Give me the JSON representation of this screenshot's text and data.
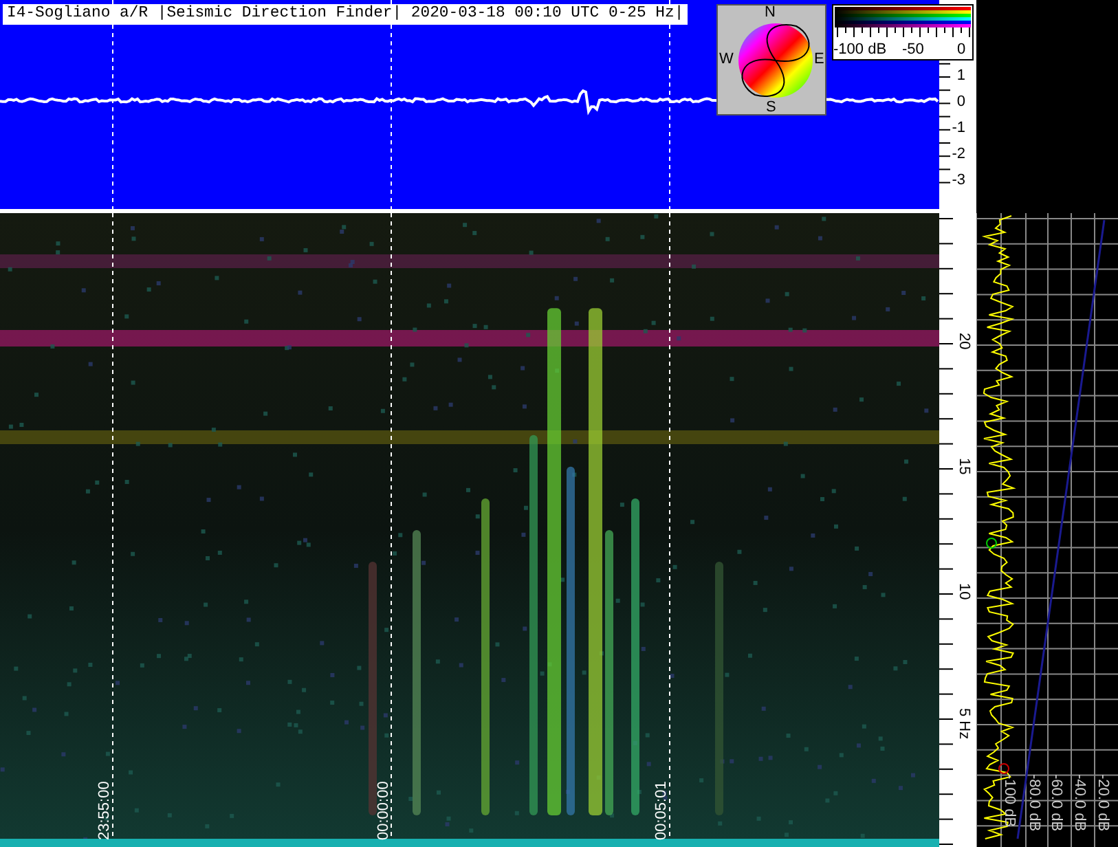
{
  "title": "I4-Sogliano a/R |Seismic Direction Finder| 2020-03-18 00:10 UTC 0-25 Hz|",
  "compass": {
    "north": "N",
    "east": "E",
    "south": "S",
    "west": "W"
  },
  "colorbar": {
    "labels": [
      "-100 dB",
      "-50",
      "0"
    ]
  },
  "amplitude_scale": {
    "labels": [
      "1",
      "0",
      "-1",
      "-2",
      "-3"
    ]
  },
  "time_marks": [
    "23:55:00",
    "00:00:00",
    "00:05:01"
  ],
  "frequency_scale": {
    "labels": [
      "20",
      "15",
      "10",
      "5 Hz"
    ]
  },
  "spectrum": {
    "db_labels": [
      "-100 dB",
      "-80.0 dB",
      "-60.0 dB",
      "-40.0 dB",
      "-20.0 dB"
    ]
  }
}
